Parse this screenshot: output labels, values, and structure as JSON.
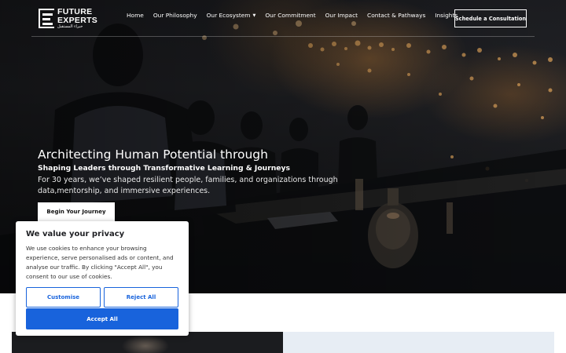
{
  "header": {
    "logo_word_1": "FUTURE",
    "logo_word_2": "EXPERTS",
    "logo_arabic": "خبراء المستقبل",
    "nav": [
      {
        "label": "Home"
      },
      {
        "label": "Our Philosophy"
      },
      {
        "label": "Our Ecosystem",
        "has_dropdown": true
      },
      {
        "label": "Our Commitment"
      },
      {
        "label": "Our Impact"
      },
      {
        "label": "Contact & Pathways"
      },
      {
        "label": "Insights"
      }
    ],
    "cta_label": "Schedule a Consultation"
  },
  "hero": {
    "title": "Architecting Human Potential through",
    "subtitle": "Shaping Leaders through Transformative Learning & Journeys",
    "body": "For 30 years, we’ve shaped resilient people, families, and organizations through data,mentorship, and immersive experiences.",
    "button_label": "Begin Your Journey"
  },
  "cookie_banner": {
    "title": "We value your privacy",
    "text": "We use cookies to enhance your browsing experience, serve personalised ads or content, and analyse our traffic. By clicking \"Accept All\", you consent to our use of cookies.",
    "customise_label": "Customise",
    "reject_label": "Reject All",
    "accept_label": "Accept All",
    "accent_color": "#1863dc"
  },
  "icons": {
    "logo": "logo-mark-icon",
    "dropdown": "chevron-down-icon"
  }
}
